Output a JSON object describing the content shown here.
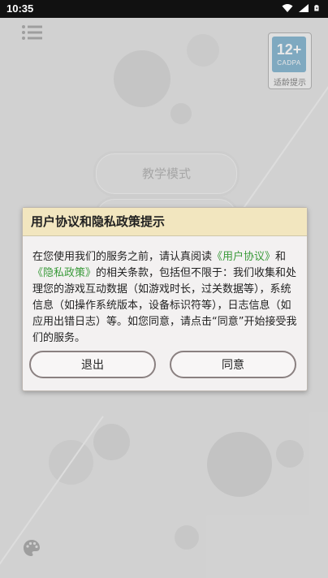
{
  "status_bar": {
    "time": "10:35",
    "icons": [
      "wifi-icon",
      "signal-icon",
      "battery-icon"
    ]
  },
  "header": {
    "menu_icon": "list-menu-icon",
    "age_rating": {
      "number": "12+",
      "org": "CADPA",
      "caption": "适龄提示"
    }
  },
  "main": {
    "buttons": [
      {
        "label": "教学模式"
      },
      {
        "label": ""
      }
    ],
    "palette_icon": "palette-icon"
  },
  "dialog": {
    "title": "用户协议和隐私政策提示",
    "body": {
      "part1": "在您使用我们的服务之前，请认真阅读",
      "link_user_agreement": "《用户协议》",
      "part2": "和",
      "link_privacy_policy": "《隐私政策》",
      "part3": "的相关条款，包括但不限于：我们收集和处理您的游戏互动数据（如游戏时长，过关数据等），系统信息（如操作系统版本，设备标识符等），日志信息（如应用出错日志）等。如您同意，请点击“同意”开始接受我们的服务。"
    },
    "exit_label": "退出",
    "agree_label": "同意"
  },
  "colors": {
    "dialog_header_bg": "#f2e6bf",
    "link": "#3a9a3a",
    "age_tile": "#5f9ec2"
  }
}
